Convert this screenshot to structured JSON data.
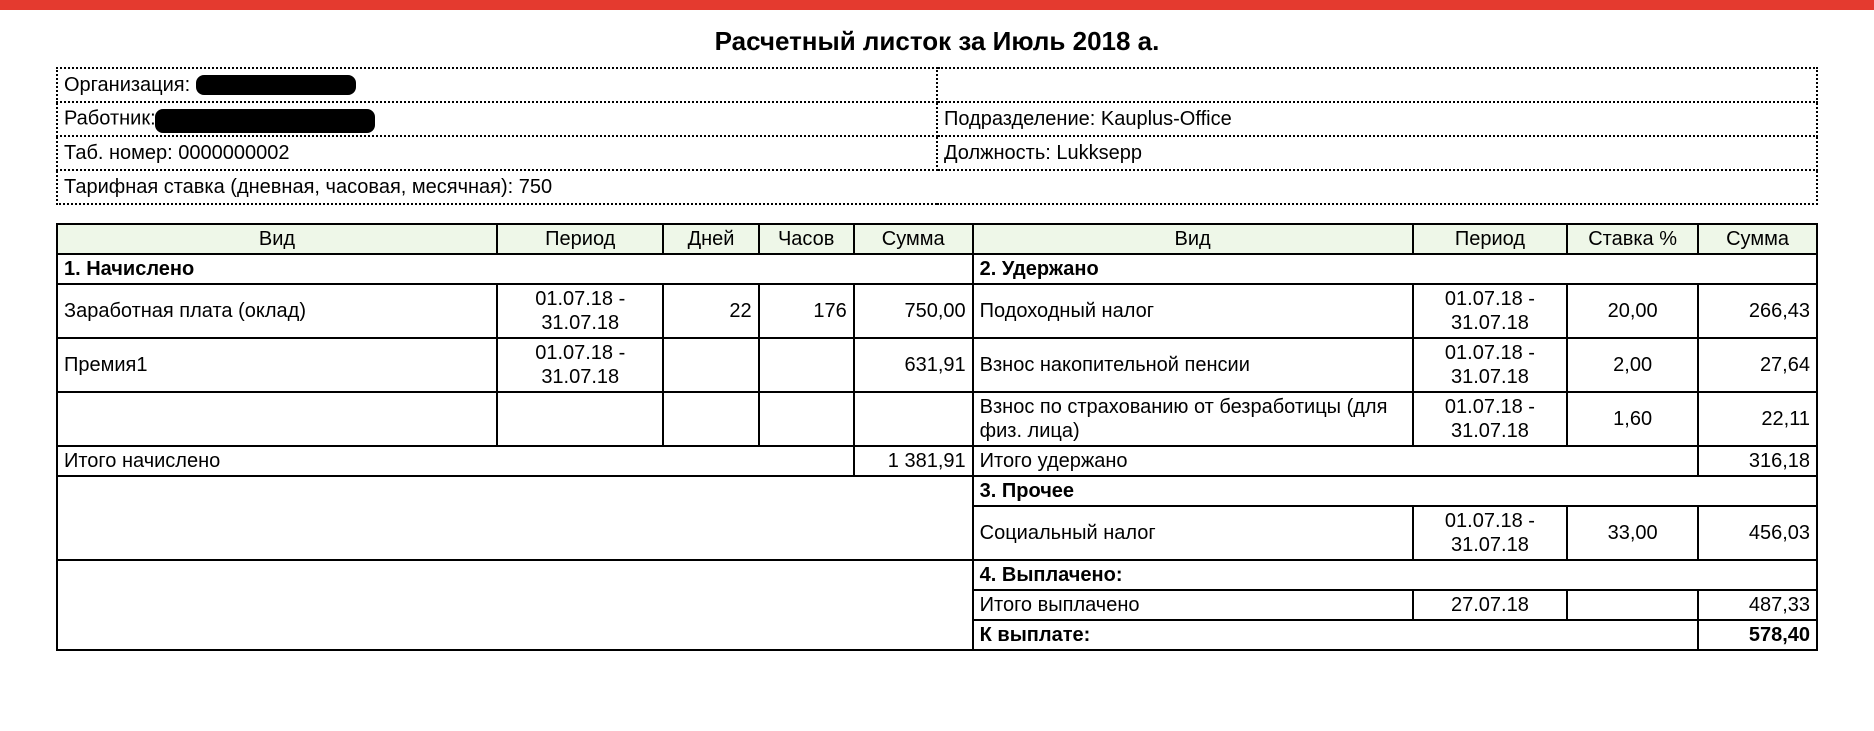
{
  "title": "Расчетный листок за Июль 2018 а.",
  "meta": {
    "org_label": "Организация:",
    "org_value": "",
    "worker_label": "Работник:",
    "worker_value": "",
    "tab_label": "Таб. номер:",
    "tab_value": "0000000002",
    "dept_label": "Подразделение:",
    "dept_value": "Kauplus-Office",
    "pos_label": "Должность:",
    "pos_value": "Lukksepp",
    "tariff_full": "Тарифная ставка (дневная, часовая, месячная): 750"
  },
  "headers": {
    "left": {
      "vid": "Вид",
      "period": "Период",
      "days": "Дней",
      "hours": "Часов",
      "sum": "Сумма"
    },
    "right": {
      "vid": "Вид",
      "period": "Период",
      "rate": "Ставка %",
      "sum": "Сумма"
    }
  },
  "sections": {
    "accrued": "1. Начислено",
    "withheld": "2. Удержано",
    "other": "3. Прочее",
    "paid": "4. Выплачено:",
    "accrued_total_label": "Итого начислено",
    "withheld_total_label": "Итого удержано",
    "paid_total_label": "Итого выплачено",
    "to_pay_label": "К выплате:"
  },
  "accrued": [
    {
      "name": "Заработная плата (оклад)",
      "period": "01.07.18 - 31.07.18",
      "days": "22",
      "hours": "176",
      "sum": "750,00"
    },
    {
      "name": "Премия1",
      "period": "01.07.18 - 31.07.18",
      "days": "",
      "hours": "",
      "sum": "631,91"
    },
    {
      "name": "",
      "period": "",
      "days": "",
      "hours": "",
      "sum": ""
    }
  ],
  "accrued_total": "1 381,91",
  "withheld": [
    {
      "name": "Подоходный налог",
      "period": "01.07.18 - 31.07.18",
      "rate": "20,00",
      "sum": "266,43"
    },
    {
      "name": "Взнос накопительной пенсии",
      "period": "01.07.18 - 31.07.18",
      "rate": "2,00",
      "sum": "27,64"
    },
    {
      "name": "Взнос по страхованию от безработицы (для физ. лица)",
      "period": "01.07.18 - 31.07.18",
      "rate": "1,60",
      "sum": "22,11"
    }
  ],
  "withheld_total": "316,18",
  "other": [
    {
      "name": "Социальный налог",
      "period": "01.07.18 - 31.07.18",
      "rate": "33,00",
      "sum": "456,03"
    }
  ],
  "paid": {
    "date": "27.07.18",
    "sum": "487,33"
  },
  "to_pay": "578,40"
}
